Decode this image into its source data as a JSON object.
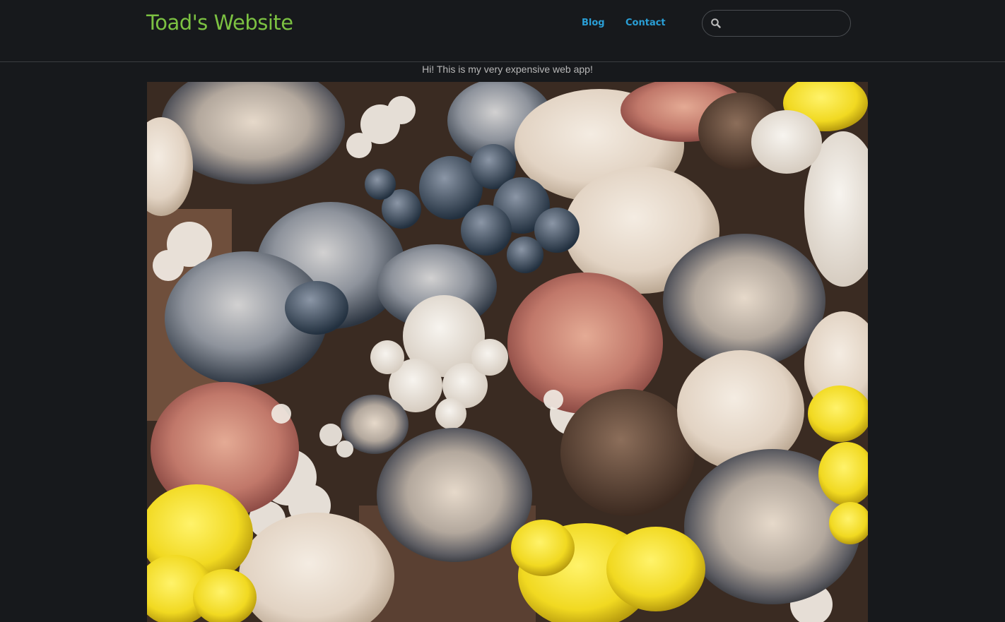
{
  "navbar": {
    "brand": "Toad's Website",
    "links": [
      {
        "label": "Blog"
      },
      {
        "label": "Contact"
      }
    ],
    "search": {
      "value": "",
      "placeholder": "",
      "icon": "search-icon"
    }
  },
  "main": {
    "tagline": "Hi! This is my very expensive web app!",
    "hero_image": {
      "subject": "assorted mushrooms",
      "alt": ""
    }
  },
  "colors": {
    "background": "#17191c",
    "brand": "#7cc242",
    "link": "#2a9fd6",
    "text": "#b8b8b8"
  }
}
